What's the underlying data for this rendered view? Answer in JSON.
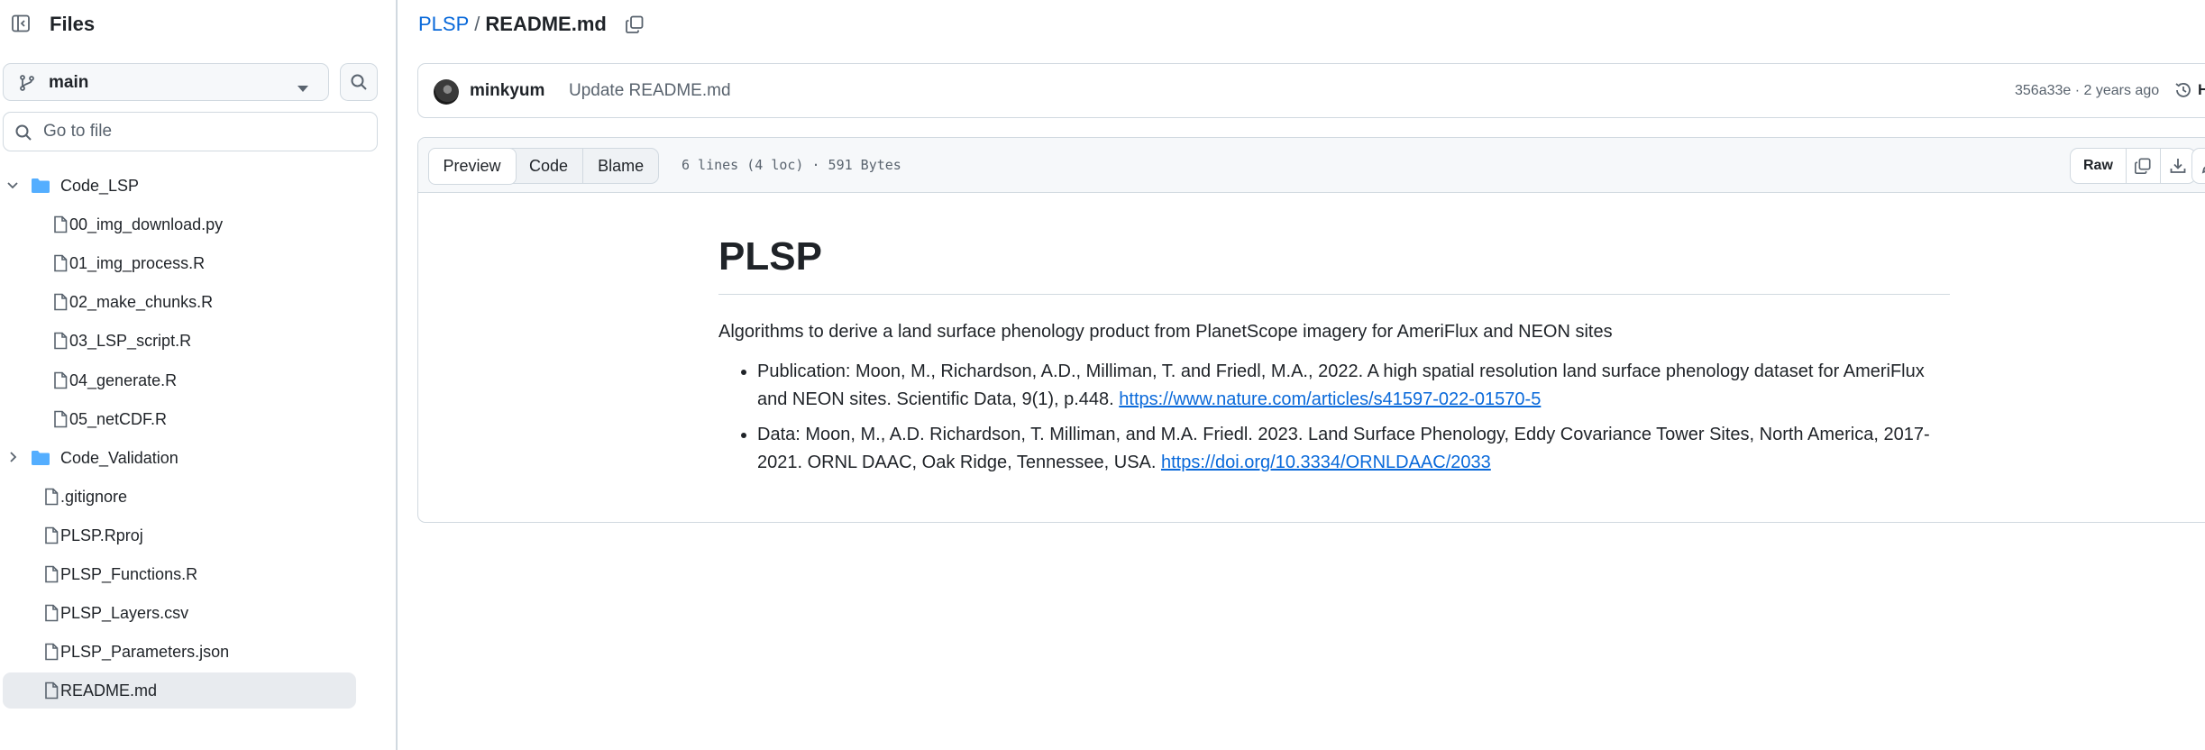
{
  "sidebar": {
    "title": "Files",
    "branch": "main",
    "goto_placeholder": "Go to file",
    "tree": [
      {
        "label": "Code_LSP",
        "type": "folder",
        "expanded": true,
        "depth": 0
      },
      {
        "label": "00_img_download.py",
        "type": "file",
        "depth": 1
      },
      {
        "label": "01_img_process.R",
        "type": "file",
        "depth": 1
      },
      {
        "label": "02_make_chunks.R",
        "type": "file",
        "depth": 1
      },
      {
        "label": "03_LSP_script.R",
        "type": "file",
        "depth": 1
      },
      {
        "label": "04_generate.R",
        "type": "file",
        "depth": 1
      },
      {
        "label": "05_netCDF.R",
        "type": "file",
        "depth": 1
      },
      {
        "label": "Code_Validation",
        "type": "folder",
        "expanded": false,
        "depth": 0
      },
      {
        "label": ".gitignore",
        "type": "file",
        "depth": 0
      },
      {
        "label": "PLSP.Rproj",
        "type": "file",
        "depth": 0
      },
      {
        "label": "PLSP_Functions.R",
        "type": "file",
        "depth": 0
      },
      {
        "label": "PLSP_Layers.csv",
        "type": "file",
        "depth": 0
      },
      {
        "label": "PLSP_Parameters.json",
        "type": "file",
        "depth": 0
      },
      {
        "label": "README.md",
        "type": "file",
        "depth": 0,
        "selected": true
      }
    ]
  },
  "breadcrumb": {
    "repo": "PLSP",
    "separator": "/",
    "file": "README.md"
  },
  "commit": {
    "author": "minkyum",
    "message": "Update README.md",
    "meta": "356a33e · 2 years ago",
    "history_label": "Hist"
  },
  "file_header": {
    "tabs": [
      "Preview",
      "Code",
      "Blame"
    ],
    "active_tab": "Preview",
    "info": "6 lines (4 loc) · 591 Bytes",
    "raw_label": "Raw"
  },
  "readme": {
    "title": "PLSP",
    "intro": "Algorithms to derive a land surface phenology product from PlanetScope imagery for AmeriFlux and NEON sites",
    "bullets": [
      {
        "text": "Publication: Moon, M., Richardson, A.D., Milliman, T. and Friedl, M.A., 2022. A high spatial resolution land surface phenology dataset for AmeriFlux and NEON sites. Scientific Data, 9(1), p.448. ",
        "link": "https://www.nature.com/articles/s41597-022-01570-5"
      },
      {
        "text": "Data: Moon, M., A.D. Richardson, T. Milliman, and M.A. Friedl. 2023. Land Surface Phenology, Eddy Covariance Tower Sites, North America, 2017-2021. ORNL DAAC, Oak Ridge, Tennessee, USA. ",
        "link": "https://doi.org/10.3334/ORNLDAAC/2033"
      }
    ]
  },
  "colors": {
    "link": "#0969da",
    "border": "#d1d9e0",
    "muted": "#59636e",
    "selected_row": "#e8ebef",
    "folder": "#54aeff"
  }
}
